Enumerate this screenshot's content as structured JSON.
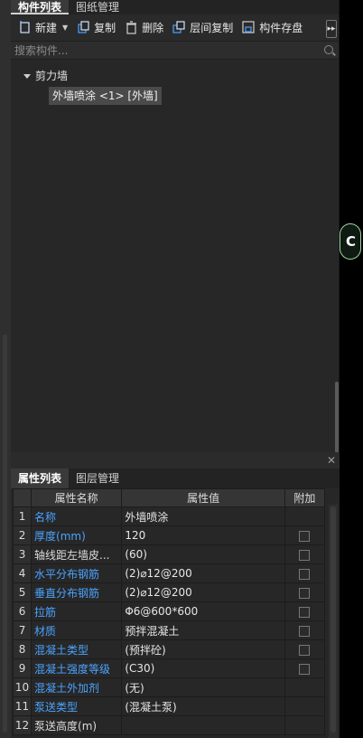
{
  "top_tabs": [
    "构件列表",
    "图纸管理"
  ],
  "toolbar": {
    "new_label": "新建",
    "copy_label": "复制",
    "delete_label": "删除",
    "floor_copy_label": "层间复制",
    "save_label": "构件存盘"
  },
  "search": {
    "placeholder": "搜索构件..."
  },
  "tree": {
    "group_label": "剪力墙",
    "selected_item": "外墙喷涂 <1> [外墙]"
  },
  "right_marker": "C",
  "bottom_tabs": [
    "属性列表",
    "图层管理"
  ],
  "table": {
    "headers": [
      "属性名称",
      "属性值",
      "附加"
    ],
    "rows": [
      {
        "n": "1",
        "name": "名称",
        "value": "外墙喷涂",
        "blue": true,
        "checkbox": false
      },
      {
        "n": "2",
        "name": "厚度(mm)",
        "value": "120",
        "blue": true,
        "checkbox": true
      },
      {
        "n": "3",
        "name": "轴线距左墙皮...",
        "value": "(60)",
        "blue": false,
        "checkbox": true
      },
      {
        "n": "4",
        "name": "水平分布钢筋",
        "value": "(2)⌀12@200",
        "blue": true,
        "checkbox": true
      },
      {
        "n": "5",
        "name": "垂直分布钢筋",
        "value": "(2)⌀12@200",
        "blue": true,
        "checkbox": true
      },
      {
        "n": "6",
        "name": "拉筋",
        "value": "Φ6@600*600",
        "blue": true,
        "checkbox": true
      },
      {
        "n": "7",
        "name": "材质",
        "value": "预拌混凝土",
        "blue": true,
        "checkbox": true
      },
      {
        "n": "8",
        "name": "混凝土类型",
        "value": "(预拌砼)",
        "blue": true,
        "checkbox": true
      },
      {
        "n": "9",
        "name": "混凝土强度等级",
        "value": "(C30)",
        "blue": true,
        "checkbox": true
      },
      {
        "n": "10",
        "name": "混凝土外加剂",
        "value": "(无)",
        "blue": true,
        "checkbox": false
      },
      {
        "n": "11",
        "name": "泵送类型",
        "value": "(混凝土泵)",
        "blue": true,
        "checkbox": false
      },
      {
        "n": "12",
        "name": "泵送高度(m)",
        "value": "",
        "blue": false,
        "checkbox": false
      }
    ]
  },
  "colors": {
    "accent_blue": "#4aa3ff",
    "background": "#272727"
  }
}
